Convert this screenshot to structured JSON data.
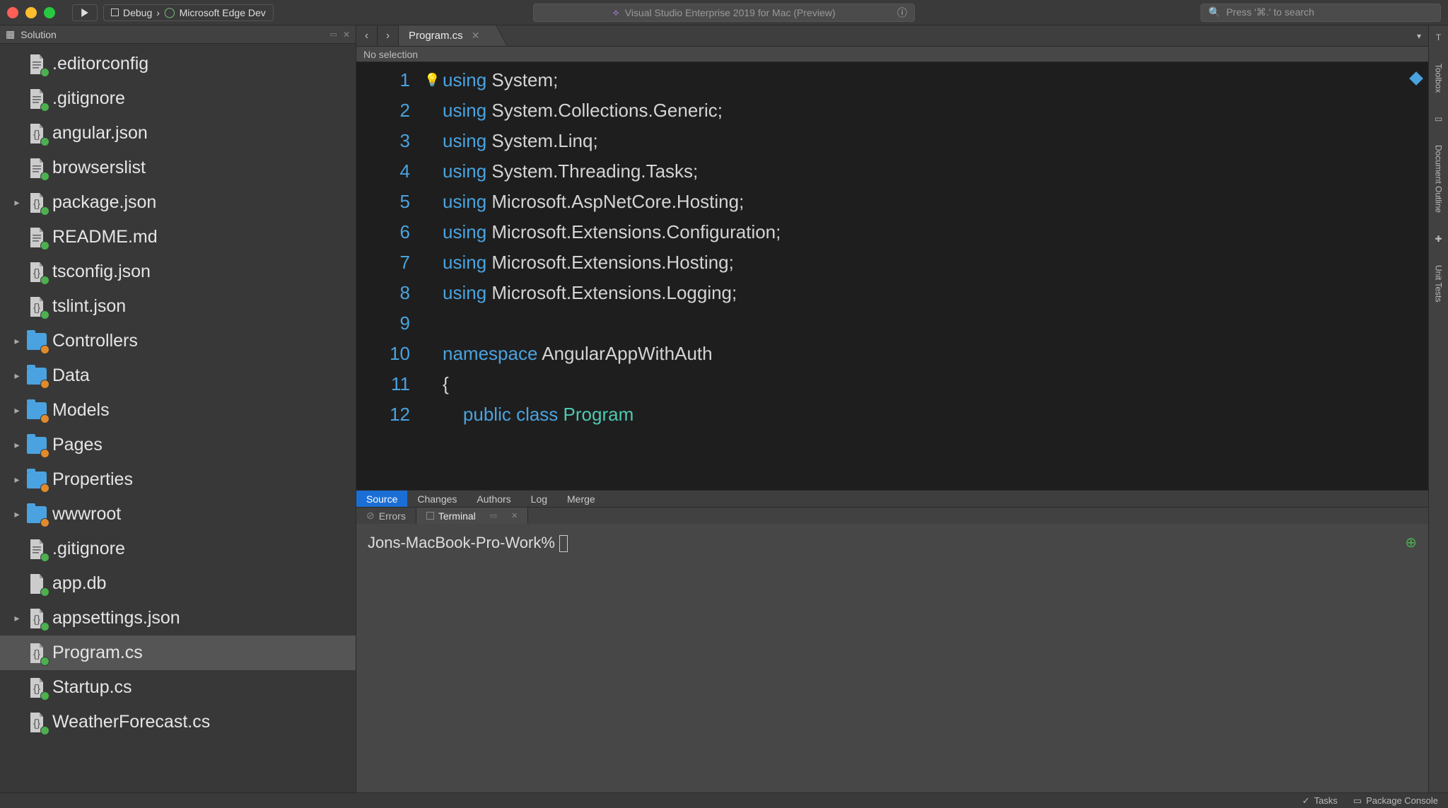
{
  "titlebar": {
    "debug_label": "Debug",
    "target_label": "Microsoft Edge Dev",
    "app_title": "Visual Studio Enterprise 2019 for Mac (Preview)",
    "search_placeholder": "Press '⌘.' to search"
  },
  "solution": {
    "title": "Solution",
    "items": [
      {
        "name": ".editorconfig",
        "icon": "file",
        "badge": "plus",
        "caret": false
      },
      {
        "name": ".gitignore",
        "icon": "file",
        "badge": "plus",
        "caret": false
      },
      {
        "name": "angular.json",
        "icon": "json",
        "badge": "plus",
        "caret": false
      },
      {
        "name": "browserslist",
        "icon": "file",
        "badge": "plus",
        "caret": false
      },
      {
        "name": "package.json",
        "icon": "json",
        "badge": "plus",
        "caret": true
      },
      {
        "name": "README.md",
        "icon": "file",
        "badge": "plus",
        "caret": false
      },
      {
        "name": "tsconfig.json",
        "icon": "json",
        "badge": "plus",
        "caret": false
      },
      {
        "name": "tslint.json",
        "icon": "json",
        "badge": "plus",
        "caret": false
      },
      {
        "name": "Controllers",
        "icon": "folder",
        "badge": "minus",
        "caret": true
      },
      {
        "name": "Data",
        "icon": "folder",
        "badge": "minus",
        "caret": true
      },
      {
        "name": "Models",
        "icon": "folder",
        "badge": "minus",
        "caret": true
      },
      {
        "name": "Pages",
        "icon": "folder",
        "badge": "minus",
        "caret": true
      },
      {
        "name": "Properties",
        "icon": "folder",
        "badge": "minus",
        "caret": true
      },
      {
        "name": "wwwroot",
        "icon": "folder",
        "badge": "minus",
        "caret": true
      },
      {
        "name": ".gitignore",
        "icon": "file",
        "badge": "plus",
        "caret": false
      },
      {
        "name": "app.db",
        "icon": "blank",
        "badge": "plus",
        "caret": false
      },
      {
        "name": "appsettings.json",
        "icon": "json",
        "badge": "plus",
        "caret": true
      },
      {
        "name": "Program.cs",
        "icon": "json",
        "badge": "plus",
        "caret": false,
        "selected": true
      },
      {
        "name": "Startup.cs",
        "icon": "json",
        "badge": "plus",
        "caret": false
      },
      {
        "name": "WeatherForecast.cs",
        "icon": "json",
        "badge": "plus",
        "caret": false
      }
    ]
  },
  "editor": {
    "tab_label": "Program.cs",
    "breadcrumb": "No selection",
    "line_count": 12,
    "code_lines": [
      [
        {
          "t": "using ",
          "c": "kw"
        },
        {
          "t": "System;",
          "c": ""
        }
      ],
      [
        {
          "t": "using ",
          "c": "kw"
        },
        {
          "t": "System.Collections.Generic;",
          "c": ""
        }
      ],
      [
        {
          "t": "using ",
          "c": "kw"
        },
        {
          "t": "System.Linq;",
          "c": ""
        }
      ],
      [
        {
          "t": "using ",
          "c": "kw"
        },
        {
          "t": "System.Threading.Tasks;",
          "c": ""
        }
      ],
      [
        {
          "t": "using ",
          "c": "kw"
        },
        {
          "t": "Microsoft.AspNetCore.Hosting;",
          "c": ""
        }
      ],
      [
        {
          "t": "using ",
          "c": "kw"
        },
        {
          "t": "Microsoft.Extensions.Configuration;",
          "c": ""
        }
      ],
      [
        {
          "t": "using ",
          "c": "kw"
        },
        {
          "t": "Microsoft.Extensions.Hosting;",
          "c": ""
        }
      ],
      [
        {
          "t": "using ",
          "c": "kw"
        },
        {
          "t": "Microsoft.Extensions.Logging;",
          "c": ""
        }
      ],
      [],
      [
        {
          "t": "namespace ",
          "c": "kw"
        },
        {
          "t": "AngularAppWithAuth",
          "c": ""
        }
      ],
      [
        {
          "t": "{",
          "c": ""
        }
      ],
      [
        {
          "t": "    ",
          "c": ""
        },
        {
          "t": "public class ",
          "c": "kw"
        },
        {
          "t": "Program",
          "c": "ty"
        }
      ]
    ]
  },
  "source_tabs": [
    "Source",
    "Changes",
    "Authors",
    "Log",
    "Merge"
  ],
  "panel_tabs": {
    "errors": "Errors",
    "terminal": "Terminal"
  },
  "terminal": {
    "prompt": "Jons-MacBook-Pro-Work% "
  },
  "right_rail": [
    "Toolbox",
    "Document Outline",
    "Unit Tests"
  ],
  "statusbar": {
    "tasks": "Tasks",
    "package": "Package Console"
  }
}
